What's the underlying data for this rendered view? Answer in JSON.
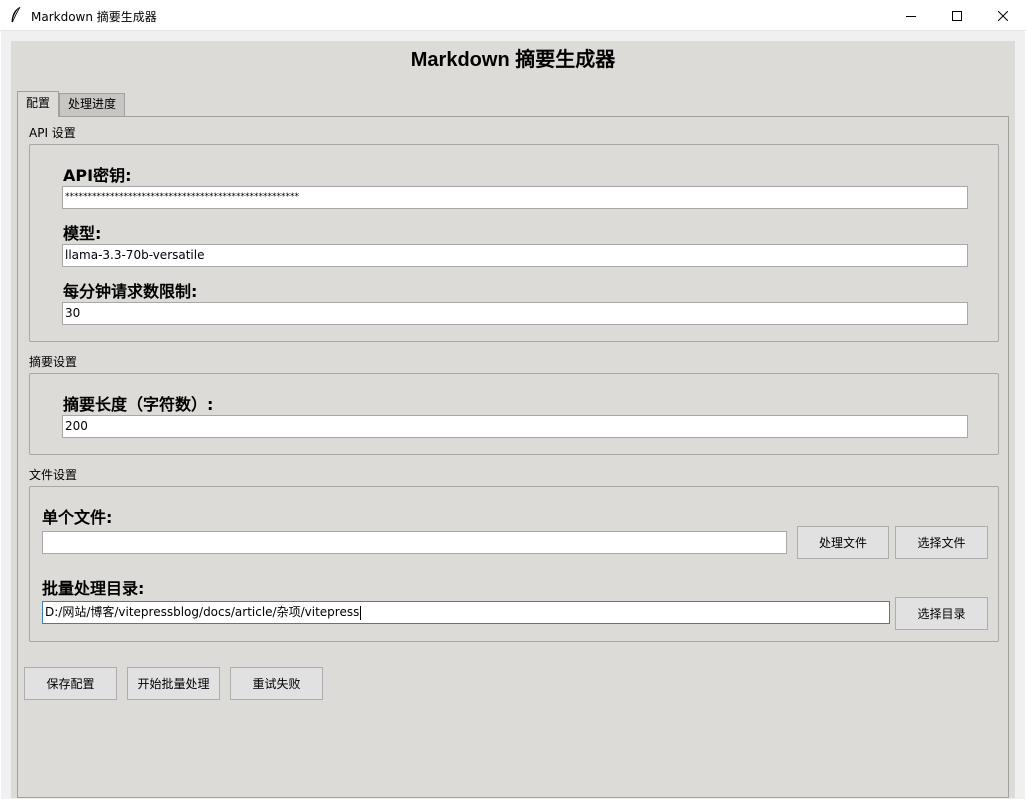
{
  "window": {
    "title": "Markdown 摘要生成器",
    "icon": "feather-icon"
  },
  "app": {
    "title": "Markdown 摘要生成器"
  },
  "tabs": [
    {
      "label": "配置",
      "selected": true
    },
    {
      "label": "处理进度",
      "selected": false
    }
  ],
  "api_settings": {
    "section_label": "API 设置",
    "api_key_label": "API密钥:",
    "api_key_value": "****************************************************",
    "model_label": "模型:",
    "model_value": "llama-3.3-70b-versatile",
    "rate_limit_label": "每分钟请求数限制:",
    "rate_limit_value": "30"
  },
  "summary_settings": {
    "section_label": "摘要设置",
    "length_label": "摘要长度（字符数）:",
    "length_value": "200"
  },
  "file_settings": {
    "section_label": "文件设置",
    "single_file_label": "单个文件:",
    "single_file_value": "",
    "process_file_button": "处理文件",
    "select_file_button": "选择文件",
    "batch_dir_label": "批量处理目录:",
    "batch_dir_value": "D:/网站/博客/vitepressblog/docs/article/杂项/vitepress",
    "select_dir_button": "选择目录"
  },
  "actions": {
    "save_config": "保存配置",
    "start_batch": "开始批量处理",
    "retry_failed": "重试失败"
  }
}
